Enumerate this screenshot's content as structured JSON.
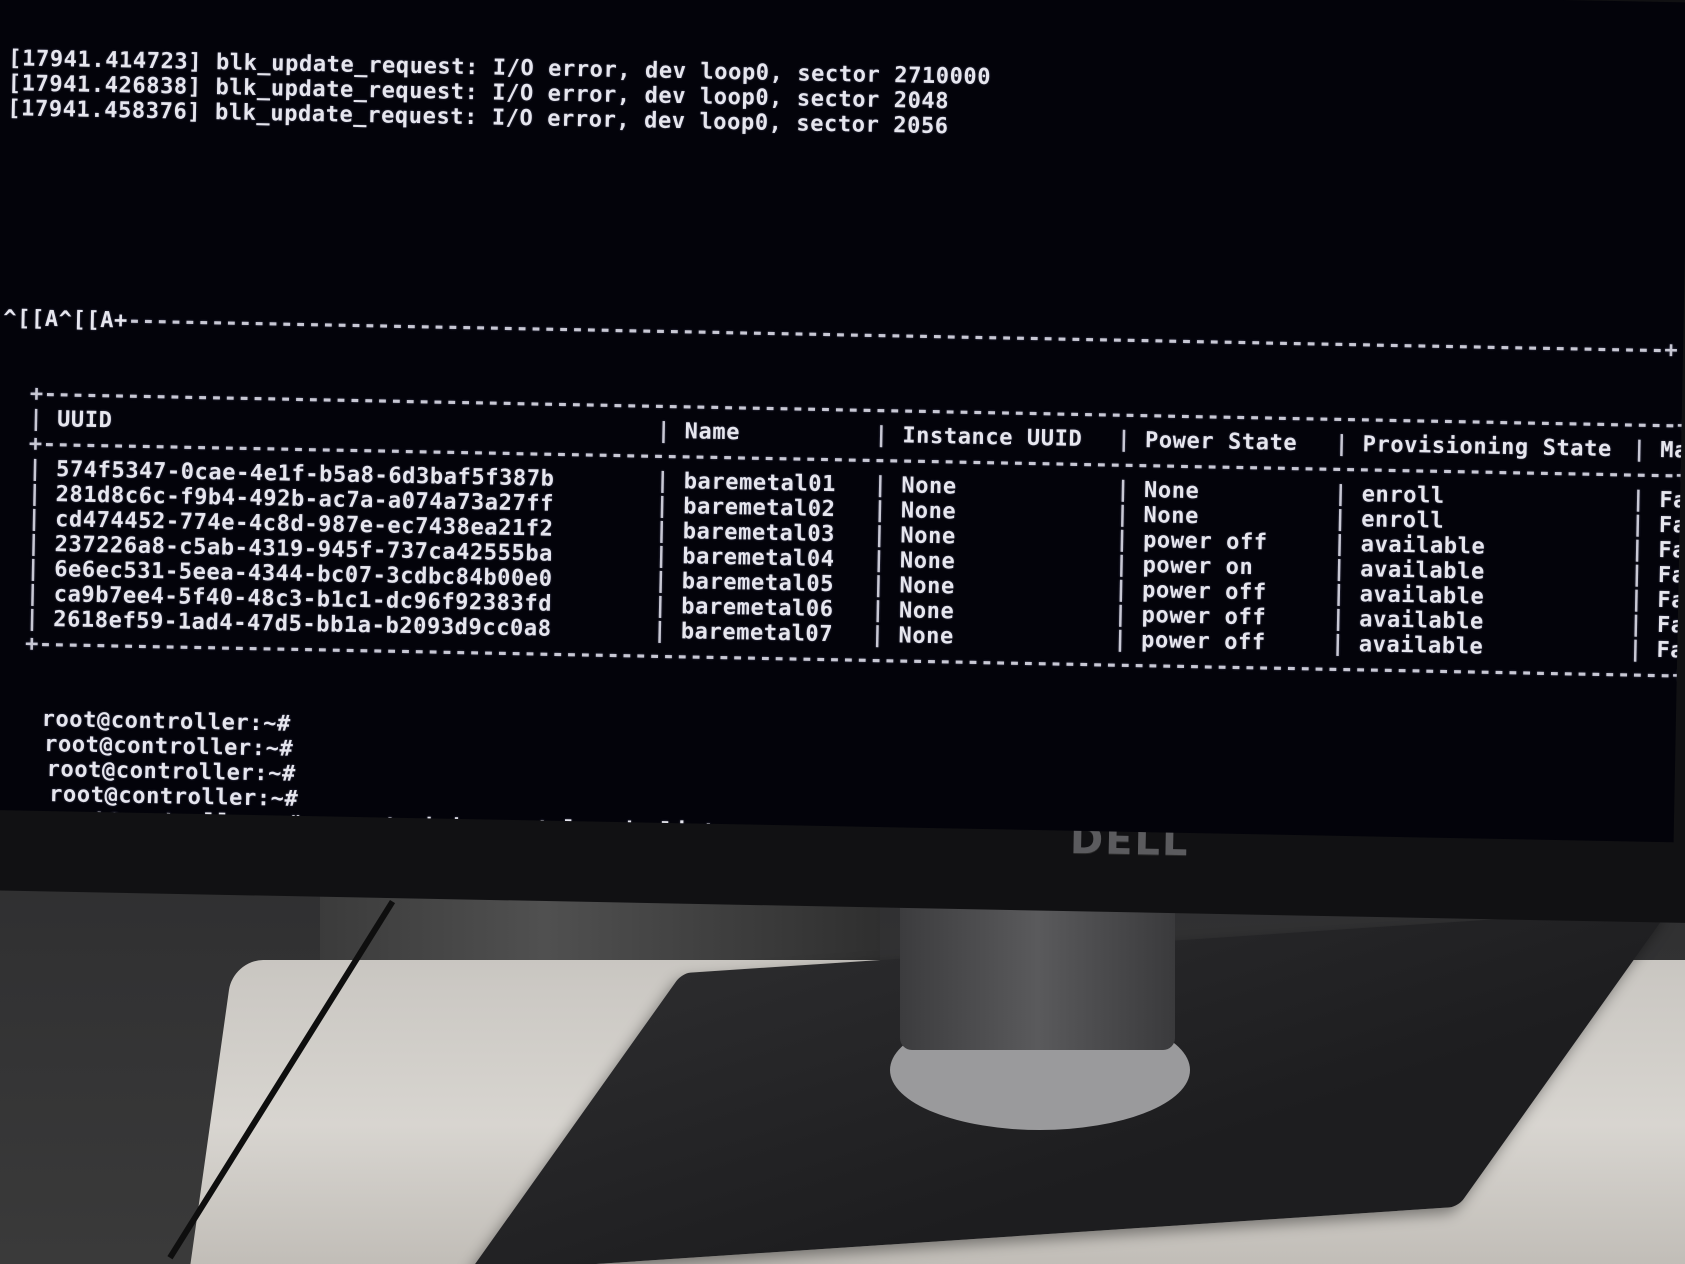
{
  "terminal": {
    "log_lines": [
      "[17941.414723] blk_update_request: I/O error, dev loop0, sector 2710000",
      "[17941.426838] blk_update_request: I/O error, dev loop0, sector 2048",
      "[17941.458376] blk_update_request: I/O error, dev loop0, sector 2056",
      "blk_update_request: I/O error, dev loop0, sector 2048"
    ],
    "escape_prefix": "^[[A^[[A+",
    "table_headers": [
      "UUID",
      "Name",
      "Instance UUID",
      "Power State",
      "Provisioning State",
      "Maintenance"
    ],
    "nodes": [
      {
        "uuid": "574f5347-0cae-4e1f-b5a8-6d3baf5f387b",
        "name": "baremetal01",
        "instance": "None",
        "power": "None",
        "provisioning": "enroll",
        "maintenance": "False"
      },
      {
        "uuid": "281d8c6c-f9b4-492b-ac7a-a074a73a27ff",
        "name": "baremetal02",
        "instance": "None",
        "power": "None",
        "provisioning": "enroll",
        "maintenance": "False"
      },
      {
        "uuid": "cd474452-774e-4c8d-987e-ec7438ea21f2",
        "name": "baremetal03",
        "instance": "None",
        "power": "power off",
        "provisioning": "available",
        "maintenance": "False"
      },
      {
        "uuid": "237226a8-c5ab-4319-945f-737ca42555ba",
        "name": "baremetal04",
        "instance": "None",
        "power": "power on",
        "provisioning": "available",
        "maintenance": "False"
      },
      {
        "uuid": "6e6ec531-5eea-4344-bc07-3cdbc84b00e0",
        "name": "baremetal05",
        "instance": "None",
        "power": "power off",
        "provisioning": "available",
        "maintenance": "False"
      },
      {
        "uuid": "ca9b7ee4-5f40-48c3-b1c1-dc96f92383fd",
        "name": "baremetal06",
        "instance": "None",
        "power": "power off",
        "provisioning": "available",
        "maintenance": "False"
      },
      {
        "uuid": "2618ef59-1ad4-47d5-bb1a-b2093d9cc0a8",
        "name": "baremetal07",
        "instance": "None",
        "power": "power off",
        "provisioning": "available",
        "maintenance": "False"
      }
    ],
    "prompt": "root@controller:~#",
    "command": "openstack baremetal node list",
    "cursor": "_"
  },
  "monitor": {
    "brand": "DELL"
  }
}
